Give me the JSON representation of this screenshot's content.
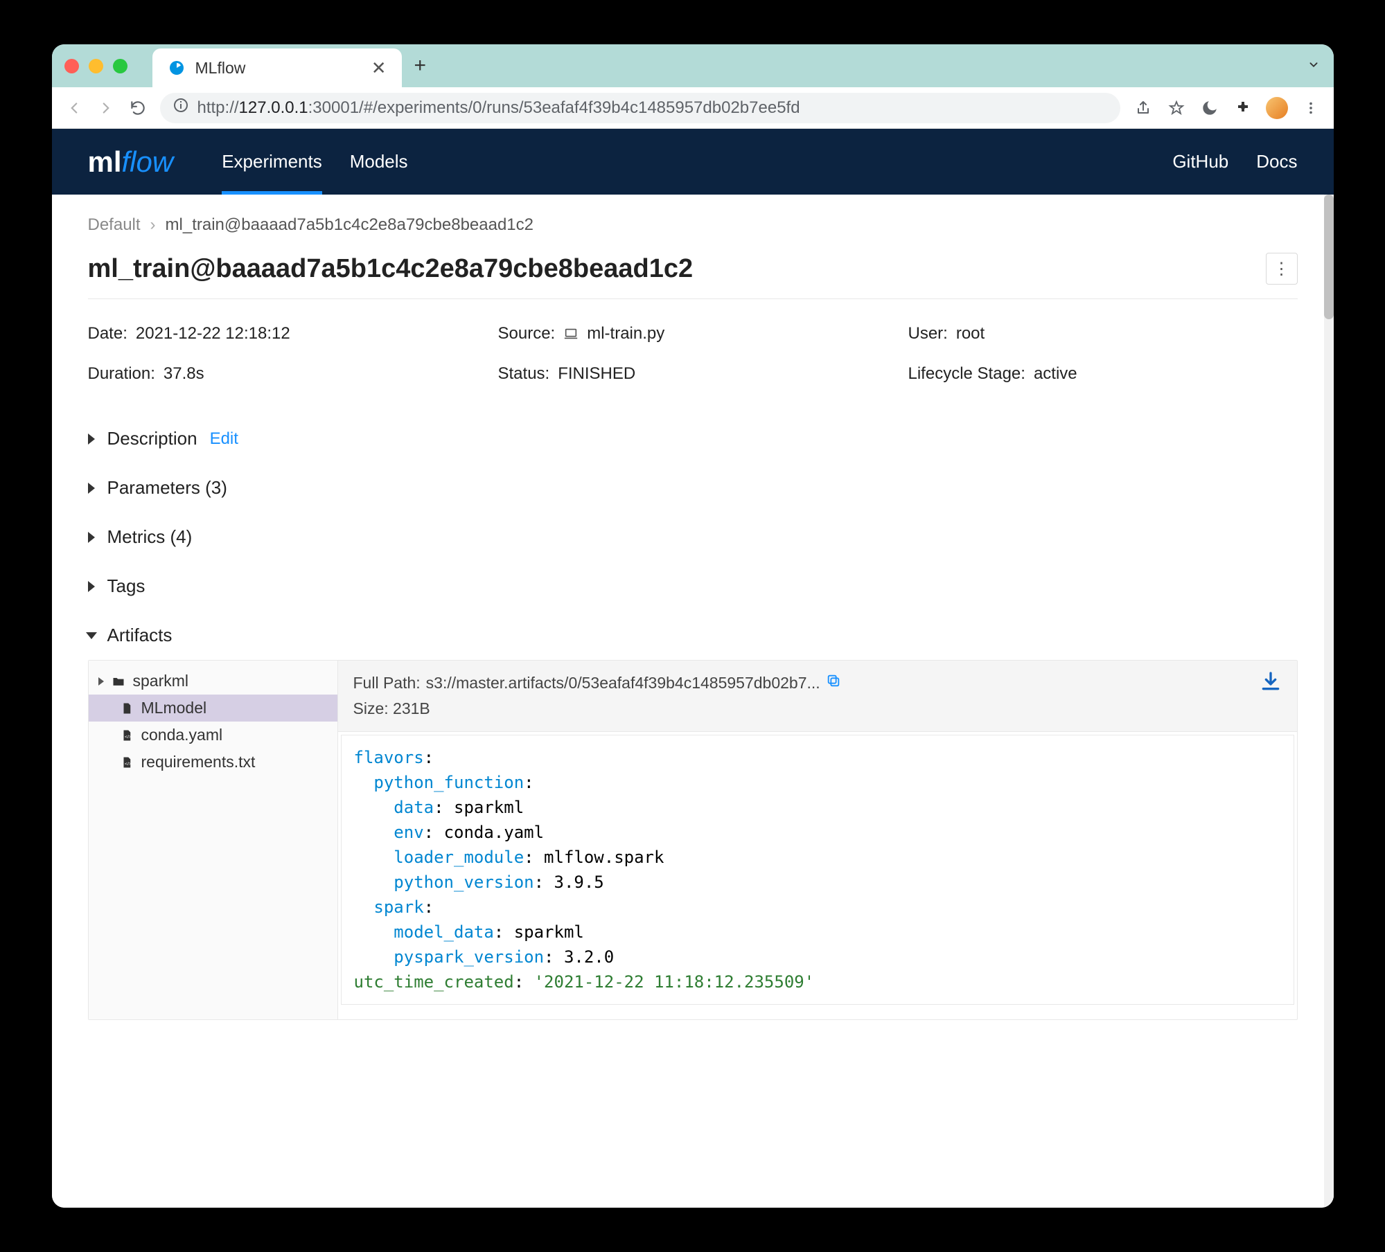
{
  "browser": {
    "tab_title": "MLflow",
    "url_prefix": "http://",
    "url_host": "127.0.0.1",
    "url_rest": ":30001/#/experiments/0/runs/53eafaf4f39b4c1485957db02b7ee5fd"
  },
  "nav": {
    "experiments": "Experiments",
    "models": "Models",
    "github": "GitHub",
    "docs": "Docs"
  },
  "breadcrumbs": {
    "root": "Default",
    "current": "ml_train@baaaad7a5b1c4c2e8a79cbe8beaad1c2"
  },
  "run_title": "ml_train@baaaad7a5b1c4c2e8a79cbe8beaad1c2",
  "meta": {
    "date_label": "Date:",
    "date_value": "2021-12-22 12:18:12",
    "source_label": "Source:",
    "source_value": "ml-train.py",
    "user_label": "User:",
    "user_value": "root",
    "duration_label": "Duration:",
    "duration_value": "37.8s",
    "status_label": "Status:",
    "status_value": "FINISHED",
    "stage_label": "Lifecycle Stage:",
    "stage_value": "active"
  },
  "sections": {
    "description": "Description",
    "edit": "Edit",
    "parameters": "Parameters (3)",
    "metrics": "Metrics (4)",
    "tags": "Tags",
    "artifacts": "Artifacts"
  },
  "tree": {
    "folder": "sparkml",
    "file_selected": "MLmodel",
    "file2": "conda.yaml",
    "file3": "requirements.txt"
  },
  "artifact": {
    "path_label": "Full Path:",
    "path_value": "s3://master.artifacts/0/53eafaf4f39b4c1485957db02b7...",
    "size_label": "Size:",
    "size_value": "231B"
  },
  "code": {
    "l1a": "flavors",
    "l1b": ":",
    "l2a": "python_function",
    "l2b": ":",
    "l3a": "data",
    "l3b": ": ",
    "l3c": "sparkml",
    "l4a": "env",
    "l4b": ": ",
    "l4c": "conda.yaml",
    "l5a": "loader_module",
    "l5b": ": ",
    "l5c": "mlflow.spark",
    "l6a": "python_version",
    "l6b": ": ",
    "l6c": "3.9.5",
    "l7a": "spark",
    "l7b": ":",
    "l8a": "model_data",
    "l8b": ": ",
    "l8c": "sparkml",
    "l9a": "pyspark_version",
    "l9b": ": ",
    "l9c": "3.2.0",
    "l10a": "utc_time_created",
    "l10b": ": ",
    "l10c": "'2021-12-22 11:18:12.235509'"
  }
}
